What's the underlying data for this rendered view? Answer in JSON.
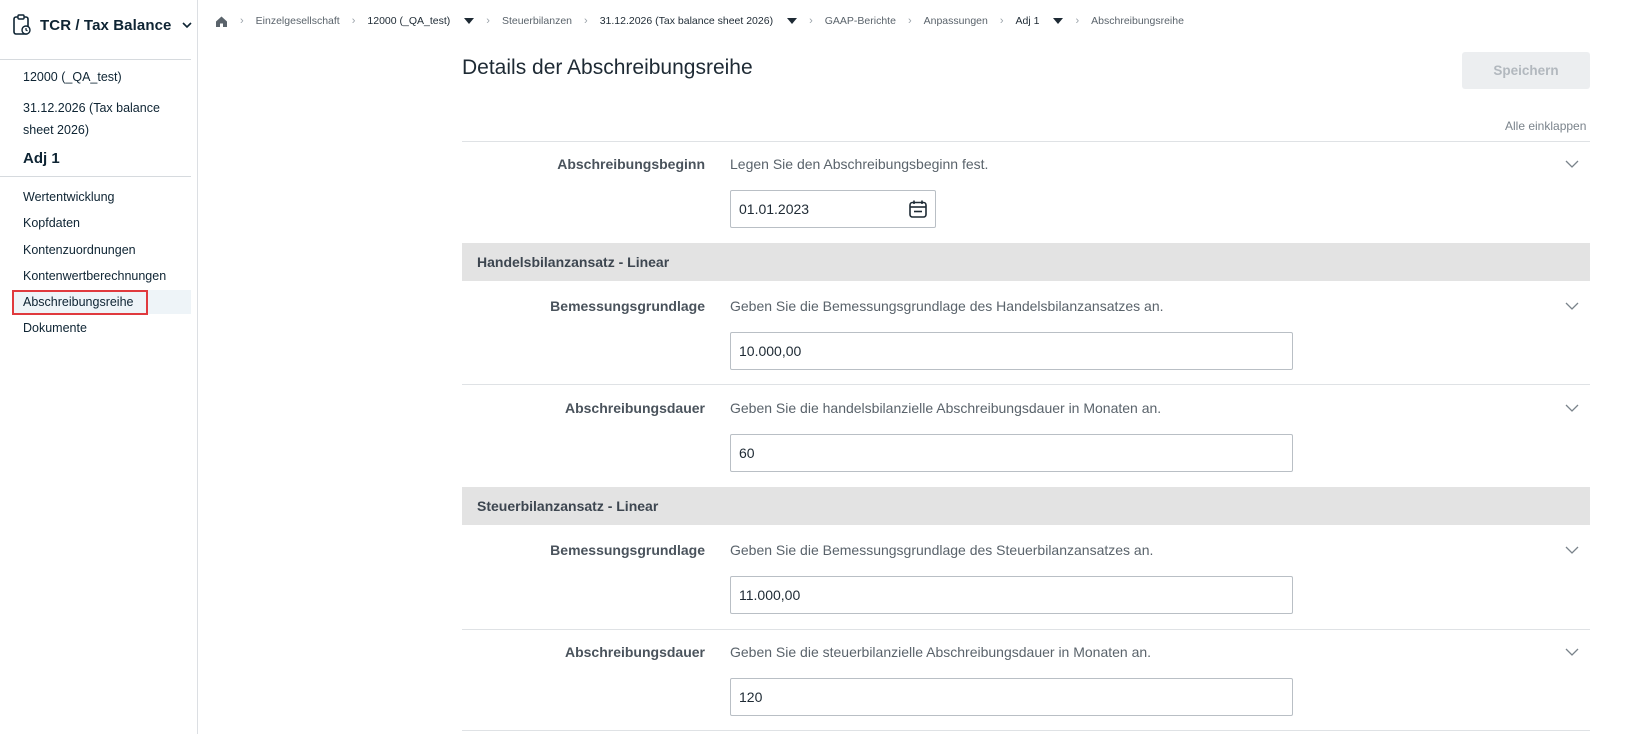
{
  "app": {
    "title": "TCR / Tax Balance",
    "icon": "clipboard-icon"
  },
  "context": {
    "entity": "12000 (_QA_test)",
    "period": "31.12.2026 (Tax balance sheet 2026)",
    "adjustment": "Adj 1"
  },
  "nav": {
    "items": [
      {
        "label": "Wertentwicklung"
      },
      {
        "label": "Kopfdaten"
      },
      {
        "label": "Kontenzuordnungen"
      },
      {
        "label": "Kontenwertberechnungen"
      },
      {
        "label": "Abschreibungsreihe",
        "active": true
      },
      {
        "label": "Dokumente"
      }
    ]
  },
  "breadcrumb": [
    {
      "label": "Einzelgesellschaft"
    },
    {
      "label": "12000 (_QA_test)",
      "dropdown": true
    },
    {
      "label": "Steuerbilanzen"
    },
    {
      "label": "31.12.2026 (Tax balance sheet 2026)",
      "dropdown": true
    },
    {
      "label": "GAAP-Berichte"
    },
    {
      "label": "Anpassungen"
    },
    {
      "label": "Adj 1",
      "dropdown": true
    },
    {
      "label": "Abschreibungsreihe"
    }
  ],
  "page": {
    "title": "Details der Abschreibungsreihe",
    "save_label": "Speichern",
    "collapse_all_label": "Alle einklappen"
  },
  "fields": {
    "start": {
      "label": "Abschreibungsbeginn",
      "help": "Legen Sie den Abschreibungsbeginn fest.",
      "value": "01.01.2023"
    },
    "commercial": {
      "section_title": "Handelsbilanzansatz - Linear",
      "basis_label": "Bemessungsgrundlage",
      "basis_help": "Geben Sie die Bemessungsgrundlage des Handelsbilanzansatzes an.",
      "basis_value": "10.000,00",
      "duration_label": "Abschreibungsdauer",
      "duration_help": "Geben Sie die handelsbilanzielle Abschreibungsdauer in Monaten an.",
      "duration_value": "60"
    },
    "tax": {
      "section_title": "Steuerbilanzansatz - Linear",
      "basis_label": "Bemessungsgrundlage",
      "basis_help": "Geben Sie die Bemessungsgrundlage des Steuerbilanzansatzes an.",
      "basis_value": "11.000,00",
      "duration_label": "Abschreibungsdauer",
      "duration_help": "Geben Sie die steuerbilanzielle Abschreibungsdauer in Monaten an.",
      "duration_value": "120"
    }
  },
  "colors": {
    "brand_text": "#0e2433",
    "highlight": "#e03a3e",
    "section_band": "#e3e3e3"
  }
}
